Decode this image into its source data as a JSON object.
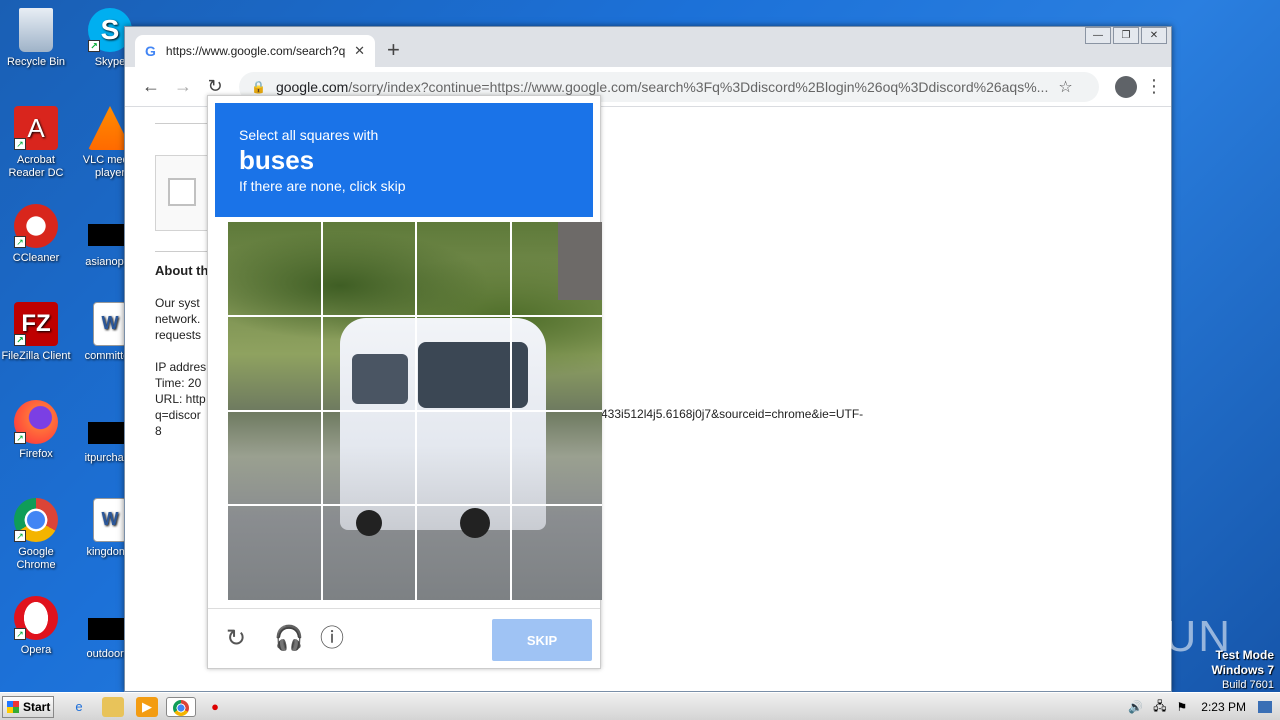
{
  "desktop": {
    "icons": [
      {
        "label": "Recycle Bin",
        "icon": "recycle-bin-icon"
      },
      {
        "label": "Skype",
        "icon": "skype-icon"
      },
      {
        "label": "Acrobat Reader DC",
        "icon": "acrobat-icon"
      },
      {
        "label": "VLC media player",
        "icon": "vlc-icon"
      },
      {
        "label": "CCleaner",
        "icon": "ccleaner-icon"
      },
      {
        "label": "asianoptic",
        "icon": "file-icon"
      },
      {
        "label": "FileZilla Client",
        "icon": "filezilla-icon"
      },
      {
        "label": "committee",
        "icon": "word-doc-icon"
      },
      {
        "label": "Firefox",
        "icon": "firefox-icon"
      },
      {
        "label": "itpurchase",
        "icon": "file-icon"
      },
      {
        "label": "Google Chrome",
        "icon": "chrome-icon"
      },
      {
        "label": "kingdomfi",
        "icon": "word-doc-icon"
      },
      {
        "label": "Opera",
        "icon": "opera-icon"
      },
      {
        "label": "outdoorgr",
        "icon": "file-icon"
      }
    ]
  },
  "browser": {
    "tab_title": "https://www.google.com/search?q=",
    "url_domain": "google.com",
    "url_rest": "/sorry/index?continue=https://www.google.com/search%3Fq%3Ddiscord%2Blogin%26oq%3Ddiscord%26aqs%..."
  },
  "page": {
    "about_heading": "About th",
    "para1": [
      "Our syst",
      "network.",
      "requests"
    ],
    "para2": [
      "IP addres",
      "Time: 20",
      "URL: http",
      "q=discor",
      "8"
    ],
    "url_tail": "433i512l4j5.6168j0j7&sourceid=chrome&ie=UTF-"
  },
  "captcha": {
    "line1": "Select all squares with",
    "target": "buses",
    "line3": "If there are none, click skip",
    "skip_label": "SKIP"
  },
  "taskbar": {
    "start_label": "Start",
    "clock": "2:23 PM"
  },
  "watermark": "ANY RUN",
  "test_mode": {
    "line1": "Test Mode",
    "line2": "Windows 7",
    "line3": "Build 7601"
  }
}
